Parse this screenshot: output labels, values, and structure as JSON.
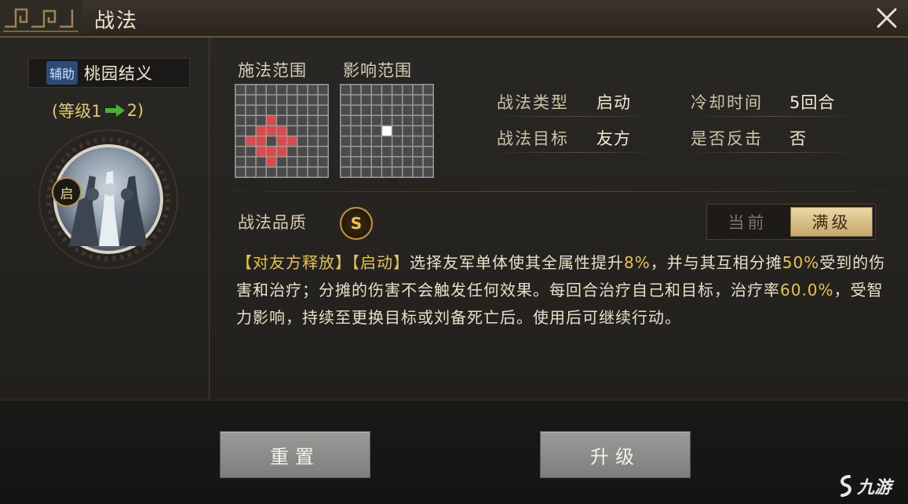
{
  "window": {
    "title": "战法",
    "close_icon": "close-icon"
  },
  "skill": {
    "tag": "辅助",
    "name": "桃园结义",
    "level_open": "(等级1",
    "level_to": "2)",
    "trigger_badge": "启",
    "icon": "skill-portrait-icon"
  },
  "ranges": {
    "cast_label": "施法范围",
    "effect_label": "影响范围",
    "cast_cells": [
      [
        3,
        3
      ],
      [
        2,
        4
      ],
      [
        3,
        4
      ],
      [
        4,
        4
      ],
      [
        1,
        5
      ],
      [
        2,
        5
      ],
      [
        4,
        5
      ],
      [
        5,
        5
      ],
      [
        2,
        6
      ],
      [
        3,
        6
      ],
      [
        4,
        6
      ],
      [
        3,
        7
      ]
    ],
    "cast_color": "#d94a4a",
    "effect_cells": [
      [
        4,
        4
      ]
    ],
    "effect_color": "#ffffff",
    "grid_color": "#9a9a9a"
  },
  "info": {
    "type_label": "战法类型",
    "type_value": "启动",
    "cooldown_label": "冷却时间",
    "cooldown_value": "5回合",
    "target_label": "战法目标",
    "target_value": "友方",
    "counter_label": "是否反击",
    "counter_value": "否"
  },
  "quality": {
    "label": "战法品质",
    "grade": "S"
  },
  "toggle": {
    "current": "当前",
    "max": "满级",
    "selected": "满级"
  },
  "description": {
    "tag1": "【对友方释放】",
    "tag2": "【启动】",
    "p1": "选择友军单体使其全属性提升",
    "v1": "8%",
    "p2": "，并与其互相分摊",
    "v2": "50%",
    "p3": "受到的伤害和治疗；分摊的伤害不会触发任何效果。每回合治疗自己和目标，治疗率",
    "v3": "60.0%",
    "p4": "，受智力影响，持续至更换目标或刘备死亡后。使用后可继续行动。"
  },
  "buttons": {
    "reset": "重置",
    "upgrade": "升级"
  },
  "watermark": {
    "text": "九游"
  },
  "colors": {
    "accent_gold": "#e8c24b",
    "arrow_green": "#4caf3a"
  }
}
